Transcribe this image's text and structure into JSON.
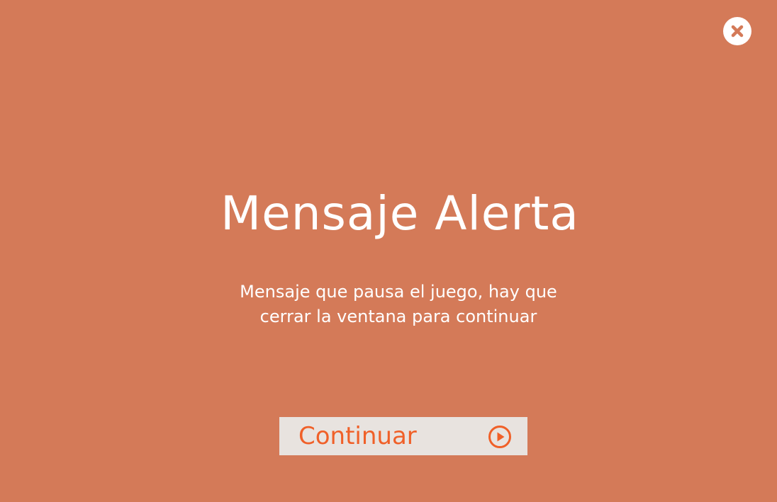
{
  "colors": {
    "background": "#d47a58",
    "text": "#ffffff",
    "button_background": "#e8e3df",
    "accent": "#f06028"
  },
  "icons": {
    "close": "close-icon",
    "play": "play-circle-icon"
  },
  "alert": {
    "title": "Mensaje Alerta",
    "message_line_1": "Mensaje que pausa el juego, hay que",
    "message_line_2": "cerrar la ventana para continuar"
  },
  "continue_button": {
    "label": "Continuar"
  }
}
